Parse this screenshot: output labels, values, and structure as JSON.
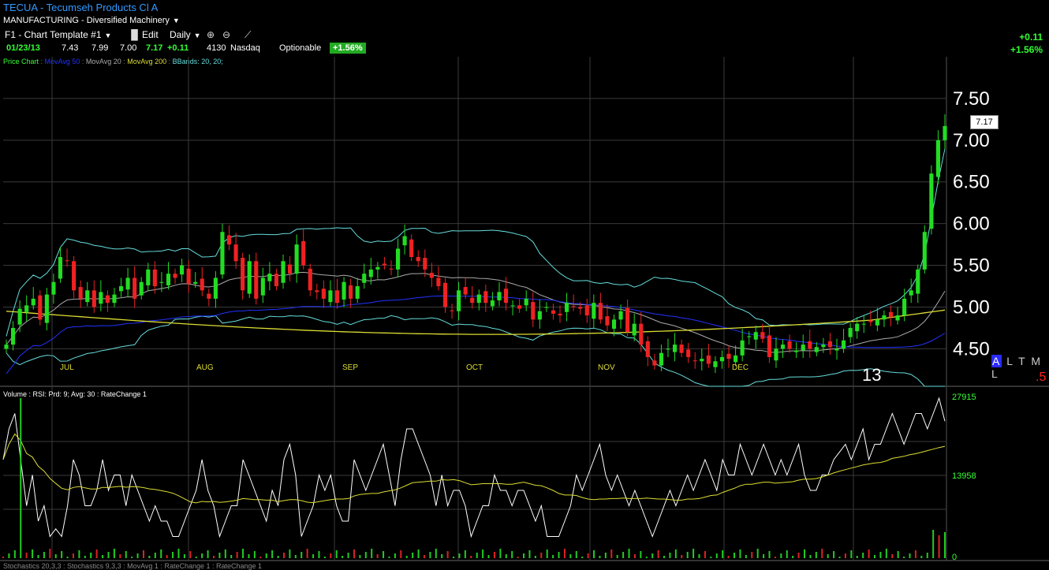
{
  "header": {
    "title": "TECUA - Tecumseh Products Cl A",
    "industry": "MANUFACTURING - Diversified Machinery",
    "template": "F1 - Chart Template #1",
    "edit": "Edit",
    "period": "Daily",
    "date": "01/23/13",
    "open": "7.43",
    "high": "7.99",
    "low": "7.00",
    "close": "7.17",
    "change": "+0.11",
    "volume": "4130",
    "exchange": "Nasdaq",
    "optionable": "Optionable",
    "pct_badge": "+1.56%",
    "right_change": "+0.11",
    "right_pct": "+1.56%"
  },
  "legend": {
    "price_chart": "Price Chart",
    "ma50": "MovAvg 50",
    "ma20": "MovAvg 20",
    "ma200": "MovAvg 200",
    "bbands": "BBands: 20, 20;"
  },
  "lower_legend": "Volume : RSI: Prd: 9; Avg: 30 : RateChange 1",
  "bottom_legend": "Stochastics 20,3,3 : Stochastics 9,3,3 : MovAvg 1 : RateChange 1 : RateChange 1",
  "last_price_tag": "7.17",
  "altml": {
    "a": "A",
    "rest": "L T M L"
  },
  "red_marker": ".5",
  "year_marker": "13",
  "colors": {
    "up": "#22dd22",
    "down": "#ee2222",
    "bband": "#66dddd",
    "ma50": "#2233ff",
    "ma20": "#aaaaaa",
    "ma200": "#dddd33",
    "grid": "#3a3a3a",
    "rsi": "#ffffff",
    "rsi_avg": "#dddd33",
    "volume": "#22cc22"
  },
  "chart_data": [
    {
      "type": "candlestick",
      "y_ticks": [
        "7.50",
        "7.00",
        "6.50",
        "6.00",
        "5.50",
        "5.00",
        "4.50"
      ],
      "ylim": [
        4.05,
        8.0
      ],
      "month_labels": [
        "JUL",
        "AUG",
        "SEP",
        "OCT",
        "NOV",
        "DEC"
      ],
      "closes": [
        4.55,
        4.75,
        4.98,
        5.02,
        5.1,
        4.85,
        5.15,
        5.3,
        5.6,
        5.55,
        5.2,
        5.1,
        5.2,
        5.0,
        5.18,
        5.05,
        5.15,
        5.25,
        5.35,
        5.1,
        5.3,
        5.45,
        5.25,
        5.3,
        5.4,
        5.35,
        5.5,
        5.28,
        5.3,
        5.2,
        5.1,
        5.35,
        5.9,
        5.75,
        5.55,
        5.2,
        5.55,
        5.1,
        5.35,
        5.4,
        5.25,
        5.55,
        5.4,
        5.75,
        5.5,
        5.2,
        5.18,
        5.1,
        5.2,
        5.05,
        5.3,
        5.1,
        5.25,
        5.4,
        5.45,
        5.48,
        5.5,
        5.45,
        5.7,
        5.85,
        5.6,
        5.55,
        5.45,
        5.35,
        5.25,
        5.0,
        4.95,
        5.2,
        5.15,
        5.05,
        5.15,
        5.05,
        5.08,
        5.18,
        5.05,
        5.02,
        4.98,
        5.1,
        4.85,
        4.95,
        5.0,
        4.92,
        4.9,
        5.05,
        5.0,
        4.98,
        4.9,
        5.05,
        4.85,
        4.78,
        4.85,
        4.95,
        4.7,
        4.8,
        4.55,
        4.4,
        4.3,
        4.45,
        4.5,
        4.55,
        4.45,
        4.4,
        4.35,
        4.38,
        4.32,
        4.35,
        4.4,
        4.38,
        4.42,
        4.6,
        4.65,
        4.7,
        4.62,
        4.4,
        4.5,
        4.55,
        4.5,
        4.48,
        4.55,
        4.5,
        4.52,
        4.55,
        4.52,
        4.5,
        4.6,
        4.75,
        4.8,
        4.8,
        4.82,
        4.85,
        4.9,
        4.88,
        4.9,
        5.1,
        5.2,
        5.45,
        5.9,
        6.6,
        7.0,
        7.17
      ],
      "ma20_last": 5.1,
      "ma50_last": 4.75,
      "ma200_last": 4.8,
      "bb_upper_last": 6.6
    },
    {
      "type": "line",
      "name": "RSI / Volume",
      "y_ticks": [
        "27915",
        "13958",
        "0"
      ],
      "rsi": [
        6,
        8,
        9,
        6,
        3,
        5,
        2,
        3,
        1,
        1.5,
        1,
        3,
        6,
        5,
        3,
        3,
        4,
        6,
        4,
        5,
        5,
        3,
        5,
        4,
        3,
        2,
        3,
        2,
        2,
        1,
        1,
        2,
        3,
        4,
        6,
        4,
        3,
        1,
        2,
        3,
        3,
        6,
        5,
        4,
        3,
        2,
        4,
        3,
        6,
        7,
        5,
        1,
        2,
        3,
        5,
        4,
        5,
        3,
        2,
        2,
        6,
        5,
        4,
        5,
        6,
        7,
        5,
        3,
        6,
        8,
        8,
        7,
        6,
        5,
        3,
        5,
        3,
        4,
        4,
        3,
        1,
        2,
        3,
        3,
        5,
        4,
        4,
        3,
        4,
        4,
        3,
        2,
        3,
        1,
        1,
        1,
        2,
        3,
        5,
        4,
        5,
        6,
        7,
        5,
        4,
        5,
        4,
        3,
        4,
        3,
        2,
        1,
        2,
        3,
        4,
        3,
        4,
        5,
        4,
        5,
        6,
        5,
        4,
        6,
        5,
        5,
        7,
        6,
        5,
        6,
        7,
        6,
        5,
        6,
        5,
        6,
        7,
        5,
        4,
        4,
        5,
        5,
        6,
        6.5,
        7,
        6,
        7,
        8,
        6,
        7,
        7,
        8,
        9,
        8,
        7,
        8,
        9,
        9,
        8,
        9,
        10,
        8.5
      ]
    }
  ]
}
